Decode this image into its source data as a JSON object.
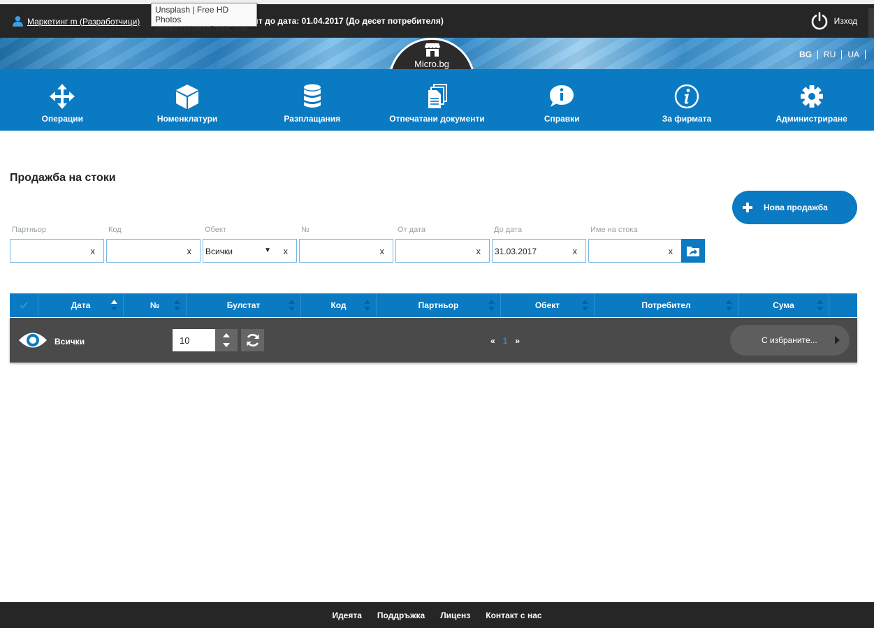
{
  "topbar": {
    "user_label": "Маркетинг m (Разработчици)",
    "license_text": "ент до дата: 01.04.2017 (До десет потребителя)",
    "logout_label": "Изход"
  },
  "tooltip": {
    "title": "Unsplash | Free HD Photos",
    "url": "https://unsplash.com"
  },
  "logo": {
    "brand": "Micro.bg"
  },
  "languages": [
    "BG",
    "RU",
    "UA"
  ],
  "nav": [
    {
      "label": "Операции",
      "icon": "arrows-move-icon"
    },
    {
      "label": "Номенклатури",
      "icon": "cube-icon"
    },
    {
      "label": "Разплащания",
      "icon": "database-icon"
    },
    {
      "label": "Отпечатани документи",
      "icon": "documents-icon"
    },
    {
      "label": "Справки",
      "icon": "info-bubble-icon"
    },
    {
      "label": "За фирмата",
      "icon": "info-circle-icon"
    },
    {
      "label": "Администриране",
      "icon": "gear-icon"
    }
  ],
  "page": {
    "title": "Продажба на стоки",
    "new_sale_label": "Нова продажба"
  },
  "filters": [
    {
      "label": "Партньор",
      "value": ""
    },
    {
      "label": "Код",
      "value": ""
    },
    {
      "label": "Обект",
      "value": "Всички"
    },
    {
      "label": "№",
      "value": ""
    },
    {
      "label": "От дата",
      "value": ""
    },
    {
      "label": "До дата",
      "value": "31.03.2017"
    },
    {
      "label": "Име на стока",
      "value": ""
    }
  ],
  "table": {
    "columns": [
      "Дата",
      "№",
      "Булстат",
      "Код",
      "Партньор",
      "Обект",
      "Потребител",
      "Сума"
    ]
  },
  "toolbar": {
    "filter_label": "Всички",
    "page_size": "10",
    "pager_prev": "«",
    "current_page": "1",
    "pager_next": "»",
    "bulk_label": "С избраните..."
  },
  "footer": [
    "Идеята",
    "Поддръжка",
    "Лиценз",
    "Контакт с нас"
  ],
  "colors": {
    "accent": "#0a7ac2",
    "dark": "#262626",
    "toolbar": "#4a4a4a"
  }
}
